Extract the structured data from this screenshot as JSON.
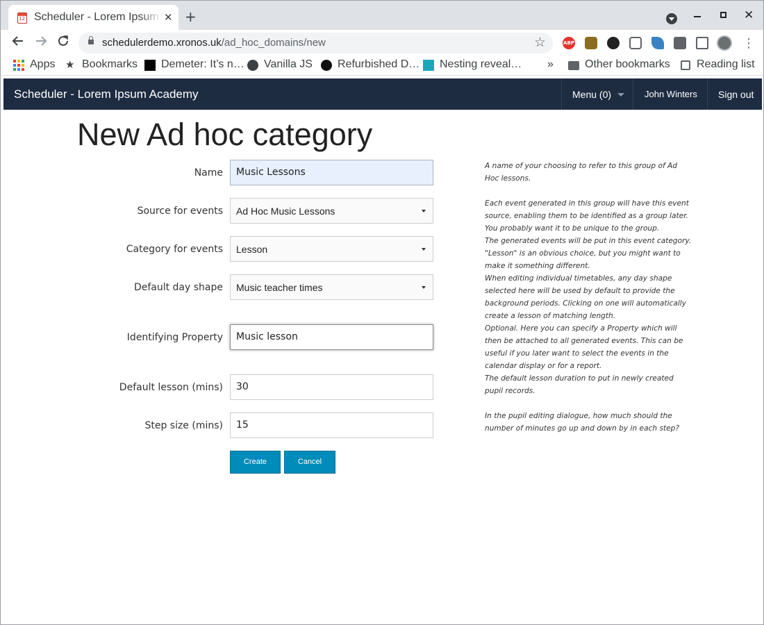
{
  "browser": {
    "tab_title": "Scheduler - Lorem Ipsum Academy",
    "tab_favicon_text": "12",
    "url_host": "schedulerdemo.xronos.uk",
    "url_path": "/ad_hoc_domains/new",
    "bookmarks": {
      "apps": "Apps",
      "bookmarks": "Bookmarks",
      "demeter": "Demeter: It’s n…",
      "vanilla": "Vanilla JS",
      "refurbished": "Refurbished D…",
      "nesting": "Nesting reveal…",
      "overflow": "»",
      "other": "Other bookmarks",
      "reading": "Reading list"
    },
    "extensions": {
      "abp": "ABP"
    }
  },
  "navbar": {
    "brand": "Scheduler - Lorem Ipsum Academy",
    "menu": "Menu (0)",
    "user": "John Winters",
    "signout": "Sign out"
  },
  "page": {
    "title": "New Ad hoc category",
    "fields": {
      "name_label": "Name",
      "name_value": "Music Lessons",
      "source_label": "Source for events",
      "source_value": "Ad Hoc Music Lessons",
      "category_label": "Category for events",
      "category_value": "Lesson",
      "dayshape_label": "Default day shape",
      "dayshape_value": "Music teacher times",
      "property_label": "Identifying Property",
      "property_value": "Music lesson",
      "lesson_label": "Default lesson (mins)",
      "lesson_value": "30",
      "step_label": "Step size (mins)",
      "step_value": "15"
    },
    "buttons": {
      "create": "Create",
      "cancel": "Cancel"
    },
    "help": {
      "name": "A name of your choosing to refer to this group of Ad Hoc lessons.",
      "source": "Each event generated in this group will have this event source, enabling them to be identified as a group later. You probably want it to be unique to the group.",
      "category": "The generated events will be put in this event category. \"Lesson\" is an obvious choice, but you might want to make it something different.",
      "dayshape": "When editing individual timetables, any day shape selected here will be used by default to provide the background periods. Clicking on one will automatically create a lesson of matching length.",
      "property": "Optional. Here you can specify a Property which will then be attached to all generated events. This can be useful if you later want to select the events in the calendar display or for a report.",
      "lesson": "The default lesson duration to put in newly created pupil records.",
      "step": "In the pupil editing dialogue, how much should the number of minutes go up and down by in each step?"
    }
  }
}
